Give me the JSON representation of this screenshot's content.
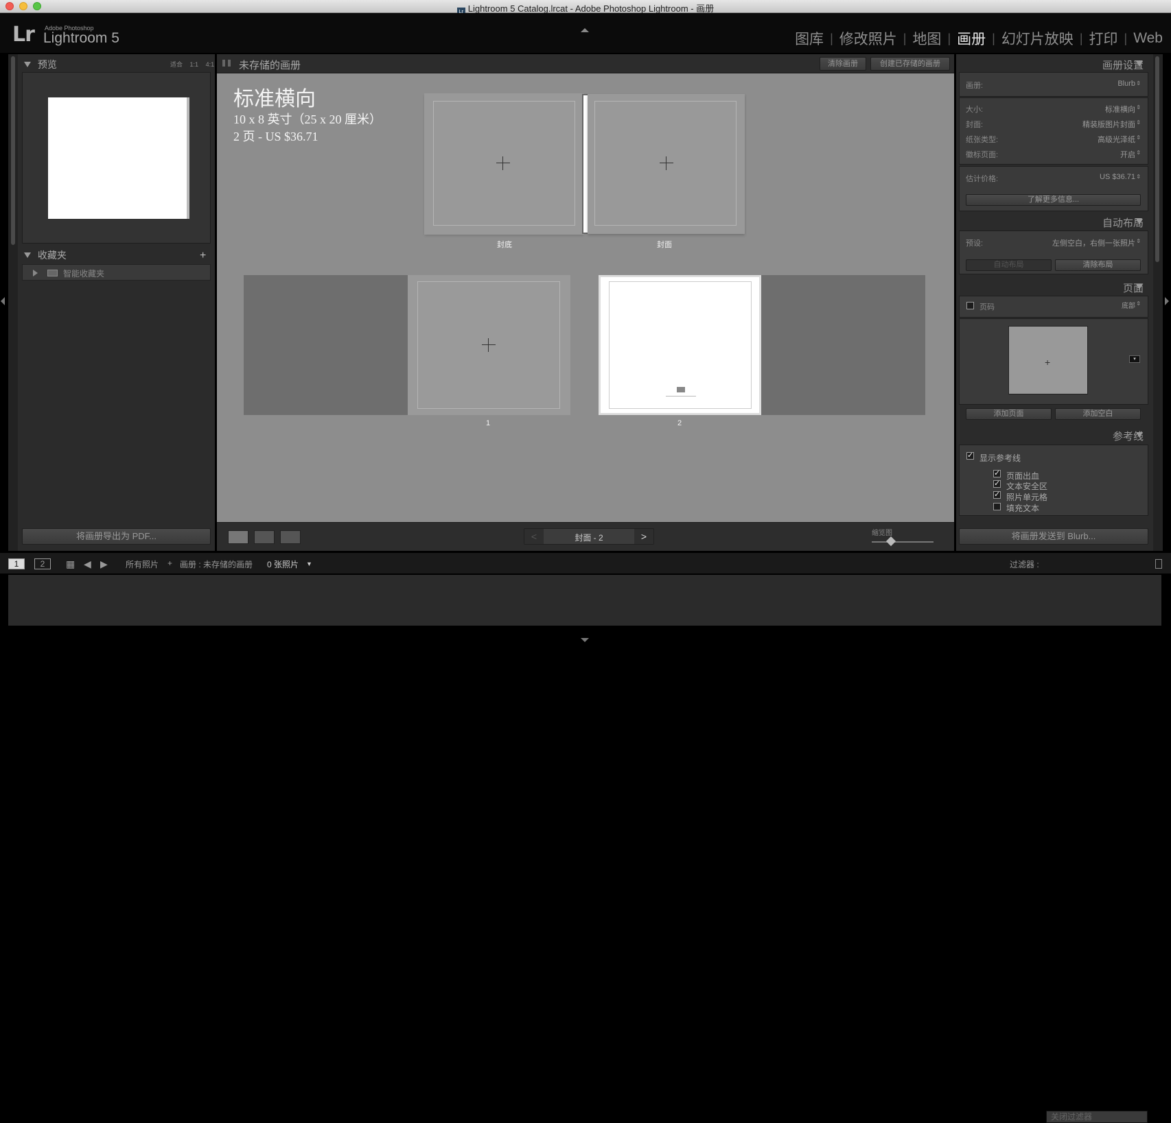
{
  "window": {
    "title": "Lightroom 5 Catalog.lrcat - Adobe Photoshop Lightroom - 画册",
    "doc_icon": "Lr"
  },
  "identity": {
    "logo": "Lr",
    "adobe": "Adobe Photoshop",
    "product": "Lightroom 5"
  },
  "modules": [
    "图库",
    "修改照片",
    "地图",
    "画册",
    "幻灯片放映",
    "打印",
    "Web"
  ],
  "module_active": "画册",
  "left": {
    "preview": {
      "title": "预览",
      "fit": "适合",
      "one_one": "1:1",
      "four_one": "4:1"
    },
    "collections": {
      "title": "收藏夹",
      "add": "+",
      "smart": "智能收藏夹"
    },
    "export_pdf": "将画册导出为 PDF..."
  },
  "center": {
    "header": {
      "title": "未存储的画册",
      "clear": "清除画册",
      "create": "创建已存储的画册"
    },
    "info": {
      "title": "标准横向",
      "size": "10 x 8 英寸（25 x 20 厘米）",
      "price": "2 页 - US $36.71"
    },
    "cover": {
      "back": "封底",
      "front": "封面"
    },
    "pages": {
      "p1": "1",
      "p2": "2"
    },
    "pager": {
      "label": "封面 - 2",
      "prev": "<",
      "next": ">"
    },
    "zoom": {
      "label": "缩览图"
    }
  },
  "right": {
    "book_settings": {
      "title": "画册设置",
      "book": {
        "label": "画册:",
        "value": "Blurb"
      },
      "size": {
        "label": "大小:",
        "value": "标准横向"
      },
      "cover": {
        "label": "封面:",
        "value": "精装版图片封面"
      },
      "paper": {
        "label": "纸张类型:",
        "value": "高级光泽纸"
      },
      "logo_page": {
        "label": "徽标页面:",
        "value": "开启"
      },
      "price": {
        "label": "估计价格:",
        "value": "US $36.71"
      },
      "learn_more": "了解更多信息..."
    },
    "auto_layout": {
      "title": "自动布局",
      "preset": {
        "label": "预设:",
        "value": "左侧空白，右侧一张照片"
      },
      "auto_btn": "自动布局",
      "clear_btn": "清除布局"
    },
    "page": {
      "title": "页面",
      "page_numbers": "页码",
      "page_numbers_value": "底部",
      "add_page": "添加页面",
      "add_blank": "添加空白"
    },
    "guides": {
      "title": "参考线",
      "show": "显示参考线",
      "items": [
        "页面出血",
        "文本安全区",
        "照片单元格",
        "填充文本"
      ],
      "checked": [
        true,
        true,
        true,
        false
      ]
    },
    "send": "将画册发送到 Blurb..."
  },
  "filmstrip": {
    "screen1": "1",
    "screen2": "2",
    "source": "所有照片",
    "plus": "+",
    "collection": "画册 : 未存储的画册",
    "count": "0 张照片",
    "filter_label": "过滤器 :",
    "filter_value": "关闭过滤器"
  }
}
